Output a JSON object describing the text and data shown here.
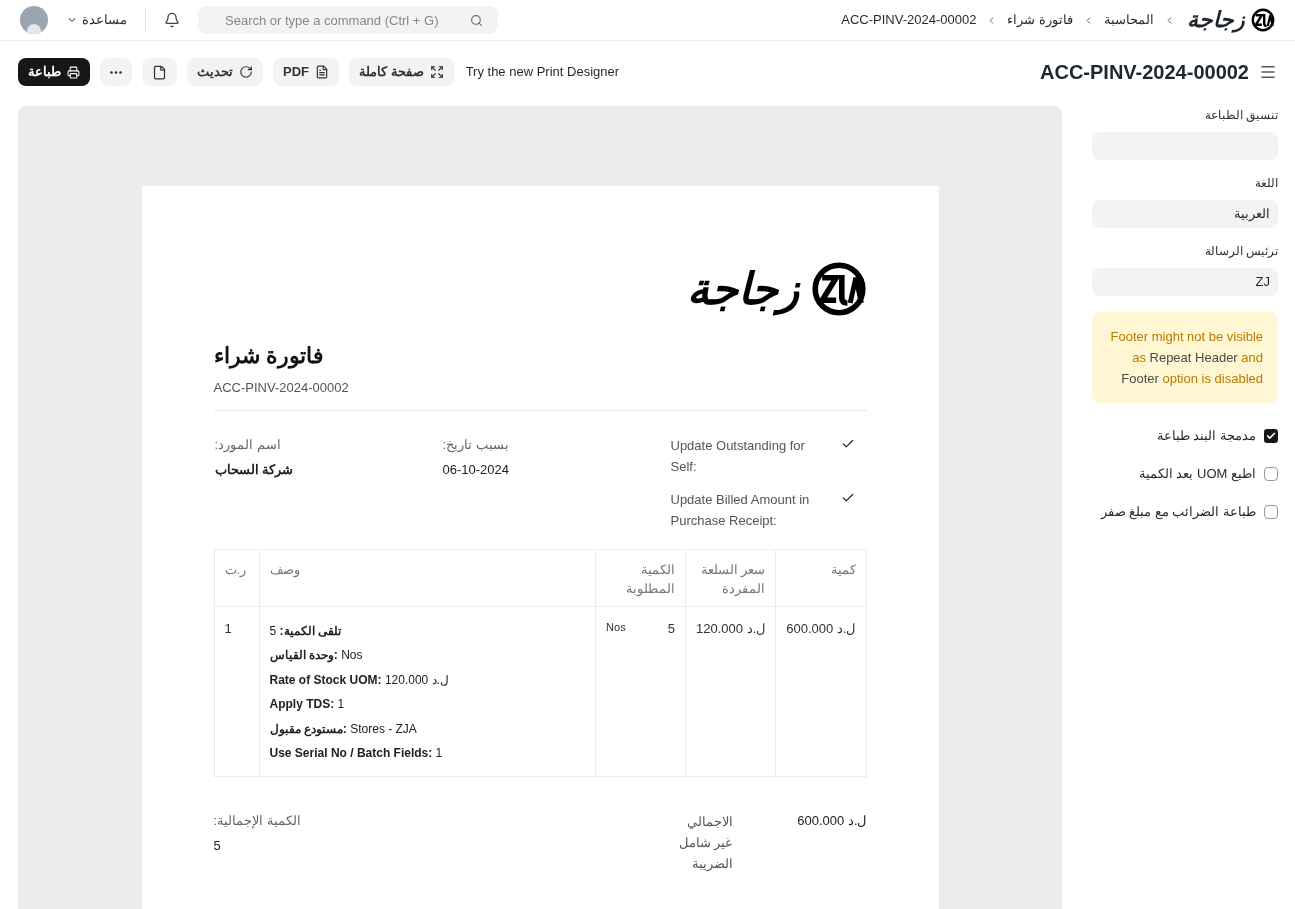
{
  "navbar": {
    "logo_text": "زجاجة",
    "breadcrumbs": [
      "المحاسبة",
      "فاتورة شراء",
      "ACC-PINV-2024-00002"
    ],
    "search": {
      "placeholder": "Search or type a command (Ctrl + G)"
    },
    "help": "مساعدة"
  },
  "toolbar": {
    "title": "ACC-PINV-2024-00002",
    "designer_link": "Try the new Print Designer",
    "buttons": [
      {
        "kind": "full_page",
        "label": "صفحة كاملة"
      },
      {
        "kind": "pdf",
        "label": "PDF"
      },
      {
        "kind": "refresh",
        "label": "تحديث"
      },
      {
        "kind": "new_doc"
      },
      {
        "kind": "more"
      },
      {
        "kind": "print",
        "label": "طباعة"
      }
    ]
  },
  "sidebar": {
    "fields": [
      {
        "label": "تنسيق الطباعة"
      },
      {
        "label": "اللغة",
        "value": "العربية"
      },
      {
        "label": "ترئيس الرسالة",
        "value": "ZJ"
      }
    ],
    "alert": "Footer might not be visible as **Repeat Header** and **Footer** option is disabled",
    "checkboxes": [
      {
        "label": "مدمجة البند طباعة",
        "checked": true
      },
      {
        "label": "اطبع UOM بعد الكمية",
        "checked": false
      },
      {
        "label": "طباعة الضرائب مع مبلغ صفر",
        "checked": false
      }
    ]
  },
  "document": {
    "logo_text": "زجاجة",
    "title": "فاتورة شراء",
    "number": "ACC-PINV-2024-00002",
    "checks": [
      {
        "label": "Update Outstanding for Self:",
        "checked": true
      },
      {
        "label": "Update Billed Amount in Purchase Receipt:",
        "checked": true
      }
    ],
    "fields": [
      {
        "label": "بسبب تاريخ:",
        "value": "06-10-2024",
        "bold": false
      },
      {
        "label": "اسم المورد:",
        "value": "شركة السحاب",
        "bold": true
      }
    ],
    "table": {
      "columns": [
        "كمية",
        "سعر السلعة المفردة",
        "الكمية المطلوبة",
        "وصف",
        "ر.ت"
      ],
      "rows": [
        {
          "amount": "ل.د 600.000",
          "rate": "ل.د 120.000",
          "qty": "5",
          "uom": "Nos",
          "description": [
            "**تلقى الكمية:** 5",
            "**وحدة القياس:** Nos",
            "**Rate of Stock UOM:** ل.د 120.000",
            "**Apply TDS:** 1",
            "**مستودع مقبول:** Stores - ZJA",
            "**Use Serial No / Batch Fields:** 1"
          ],
          "sr": "1"
        }
      ]
    },
    "net_total": {
      "label": "الاجمالي غير شامل الضريبة",
      "value": "ل.د 600.000"
    },
    "total_qty": {
      "label": "الكمية الإجمالية:",
      "value": "5"
    }
  }
}
